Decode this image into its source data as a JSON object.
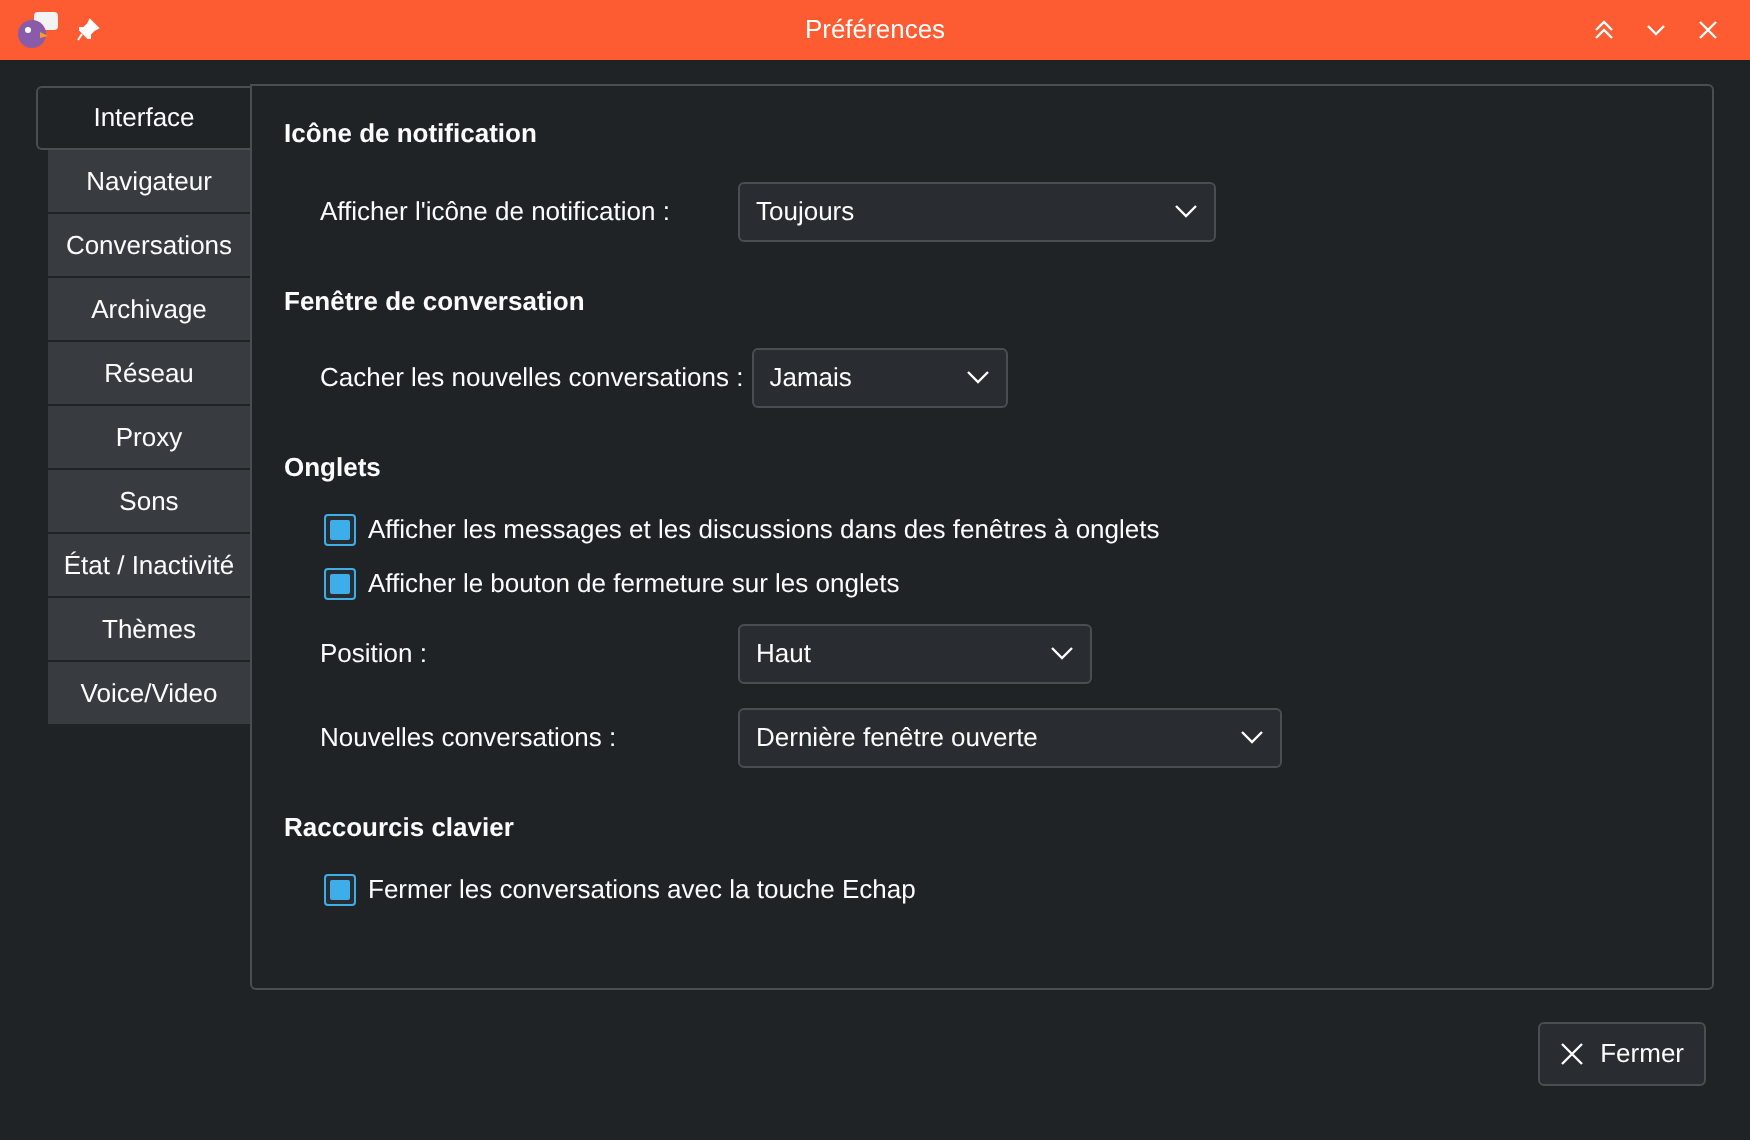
{
  "window": {
    "title": "Préférences"
  },
  "tabs": [
    {
      "label": "Interface",
      "selected": true
    },
    {
      "label": "Navigateur",
      "selected": false
    },
    {
      "label": "Conversations",
      "selected": false
    },
    {
      "label": "Archivage",
      "selected": false
    },
    {
      "label": "Réseau",
      "selected": false
    },
    {
      "label": "Proxy",
      "selected": false
    },
    {
      "label": "Sons",
      "selected": false
    },
    {
      "label": "État / Inactivité",
      "selected": false
    },
    {
      "label": "Thèmes",
      "selected": false
    },
    {
      "label": "Voice/Video",
      "selected": false
    }
  ],
  "sections": [
    {
      "title": "Icône de notification",
      "items": [
        {
          "kind": "select",
          "label": "Afficher l'icône de notification :",
          "value": "Toujours"
        }
      ]
    },
    {
      "title": "Fenêtre de conversation",
      "items": [
        {
          "kind": "select",
          "label": "Cacher les nouvelles conversations :",
          "value": "Jamais"
        }
      ]
    },
    {
      "title": "Onglets",
      "items": [
        {
          "kind": "checkbox",
          "label": "Afficher les messages et les discussions dans des fenêtres à onglets",
          "checked": true
        },
        {
          "kind": "checkbox",
          "label": "Afficher le bouton de fermeture sur les onglets",
          "checked": true
        },
        {
          "kind": "select",
          "label": "Position :",
          "value": "Haut"
        },
        {
          "kind": "select",
          "label": "Nouvelles conversations :",
          "value": "Dernière fenêtre ouverte"
        }
      ]
    },
    {
      "title": "Raccourcis clavier",
      "items": [
        {
          "kind": "checkbox",
          "label": "Fermer les conversations avec la touche Echap",
          "checked": true
        }
      ]
    }
  ],
  "buttons": [
    {
      "label": "Fermer"
    }
  ]
}
